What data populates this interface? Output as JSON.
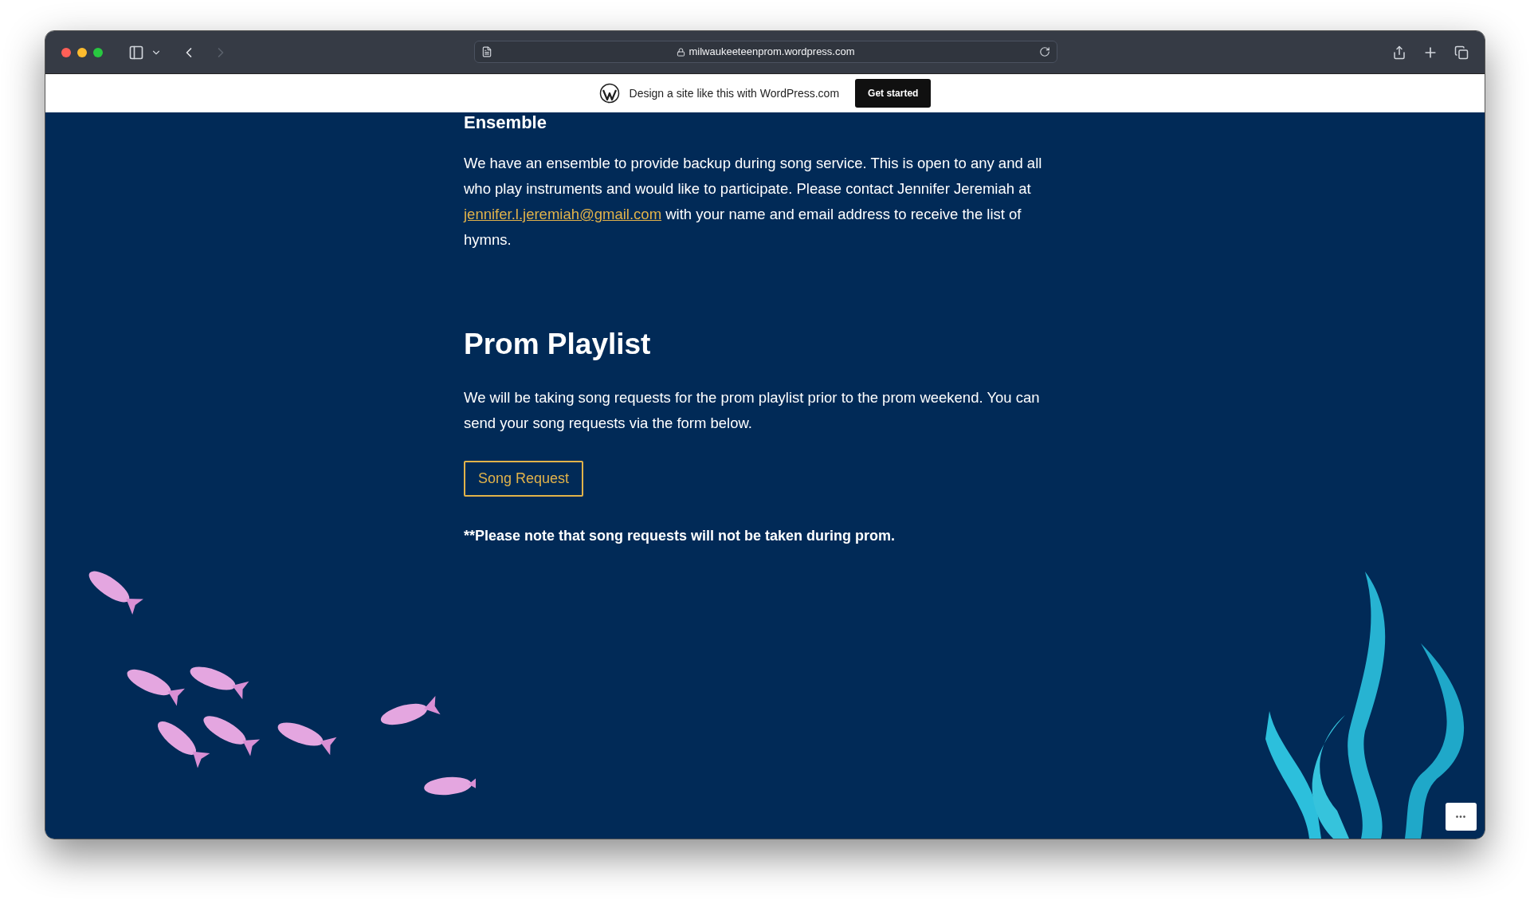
{
  "browser": {
    "url": "milwaukeeteenprom.wordpress.com",
    "nav": [
      {
        "kind": "back",
        "disabled": false
      },
      {
        "kind": "forward",
        "disabled": true
      }
    ]
  },
  "banner": {
    "text": "Design a site like this with WordPress.com",
    "button": "Get started"
  },
  "content": {
    "cut_heading": "Ensemble",
    "ensemble_paragraph": {
      "before": "We have an ensemble to provide backup during song service. This is open to any and all who play instruments and would like to participate. Please contact Jennifer Jeremiah at ",
      "link": "jennifer.l.jeremiah@gmail.com",
      "after": " with your name and email address to receive the list of hymns."
    },
    "heading": "Prom Playlist",
    "paragraph": "We will be taking song requests for the prom playlist prior to the prom weekend. You can send your song requests via the form below.",
    "button": "Song Request",
    "note": "**Please note that song requests will not be taken during prom."
  },
  "more_button": "•••"
}
